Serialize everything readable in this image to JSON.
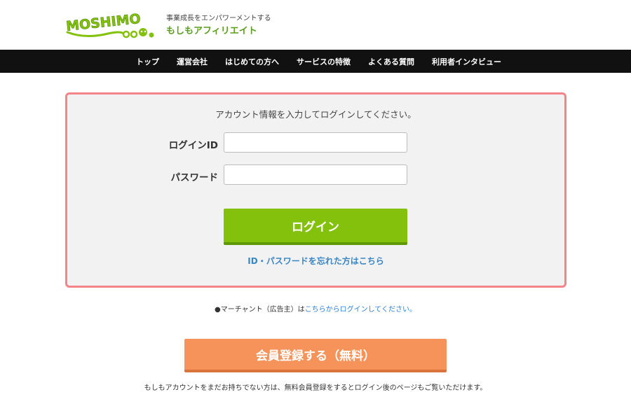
{
  "header": {
    "logo_text": "MOSHIMO",
    "tagline": "事業成長をエンパワーメントする",
    "brand_name": "もしもアフィリエイト"
  },
  "nav": {
    "items": [
      "トップ",
      "運営会社",
      "はじめての方へ",
      "サービスの特徴",
      "よくある質問",
      "利用者インタビュー"
    ]
  },
  "login": {
    "intro": "アカウント情報を入力してログインしてください。",
    "id_label": "ログインID",
    "id_value": "",
    "password_label": "パスワード",
    "password_value": "",
    "button_label": "ログイン",
    "forgot_link": "ID・パスワードを忘れた方はこちら"
  },
  "merchant": {
    "prefix": "●マーチャント（広告主）は",
    "link": "こちらからログインしてください。"
  },
  "register": {
    "button_label": "会員登録する（無料）",
    "note": "もしもアカウントをまだお持ちでない方は、無料会員登録をするとログイン後のページもご覧いただけます。"
  },
  "colors": {
    "brand_green": "#84c10c",
    "panel_border": "#f2848a",
    "register_orange": "#f5935a",
    "link_blue": "#3a86c4",
    "nav_bg": "#111111"
  }
}
